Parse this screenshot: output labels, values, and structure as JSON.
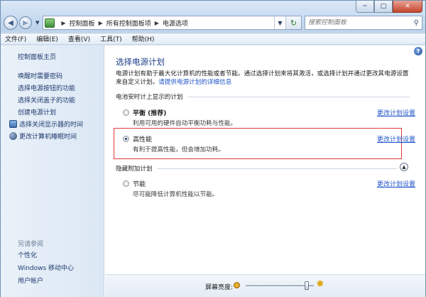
{
  "window": {
    "controls": {
      "minimize": "─",
      "maximize": "□",
      "close": "✕"
    }
  },
  "address_bar": {
    "crumbs": [
      "控制面板",
      "所有控制面板项",
      "电源选项"
    ],
    "search_placeholder": "搜索控制面板"
  },
  "menu": {
    "items": [
      "文件(F)",
      "编辑(E)",
      "查看(V)",
      "工具(T)",
      "帮助(H)"
    ]
  },
  "sidebar": {
    "home": "控制面板主页",
    "links": [
      "唤醒时需要密码",
      "选择电源按钮的功能",
      "选择关闭盖子的功能",
      "创建电源计划",
      "选择关闭显示器的时间",
      "更改计算机睡眠时间"
    ],
    "see_also_label": "另请参阅",
    "see_also": [
      "个性化",
      "Windows 移动中心",
      "用户帐户"
    ]
  },
  "main": {
    "title": "选择电源计划",
    "desc_text": "电源计划有助于最大化计算机的性能或者节能。通过选择计划来将其激活，或选择计划并通过更改其电源设置来自定义计划。",
    "desc_link": "请提供电源计划的详细信息",
    "battery_section": "电池安时计上显示的计划",
    "hidden_section": "隐藏附加计划",
    "change_link": "更改计划设置",
    "plans": [
      {
        "name": "平衡",
        "tag": "(推荐)",
        "desc": "利用可用的硬件自动平衡功耗与性能。",
        "selected": false
      },
      {
        "name": "高性能",
        "tag": "",
        "desc": "有利于提高性能，但会增加功耗。",
        "selected": true
      },
      {
        "name": "节能",
        "tag": "",
        "desc": "尽可能降低计算机性能以节能。",
        "selected": false
      }
    ],
    "accent_color": "#1e3f8a",
    "highlight_color": "#e03b3b"
  },
  "brightness": {
    "label": "屏幕亮度:",
    "level_fraction": 0.92
  }
}
